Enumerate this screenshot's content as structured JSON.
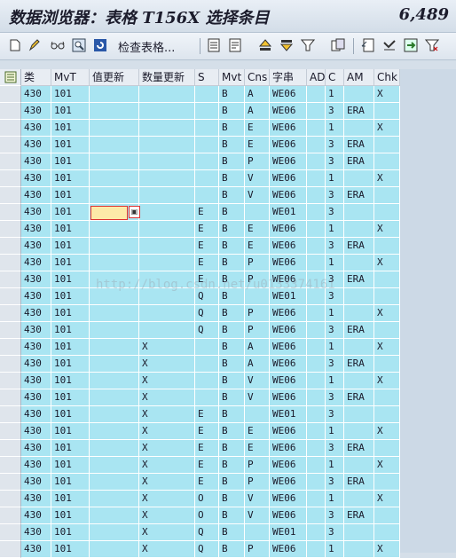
{
  "title": "数据浏览器：表格 T156X 选择条目",
  "entry_count": "6,489",
  "toolbar": {
    "check_table_label": "检查表格...",
    "icons": [
      "new-page-icon",
      "edit-pencil-icon",
      "glasses-icon",
      "find-icon",
      "refresh-icon",
      "details-icon",
      "print-icon",
      "sort-ascending-icon",
      "sort-descending-icon",
      "filter-icon",
      "total-icon",
      "export-icon",
      "layout-icon",
      "save-icon",
      "unfilter-icon"
    ]
  },
  "watermark": "http://blog.csdn.net/u0133374161",
  "table": {
    "headers": [
      "类",
      "MvT",
      "值更新",
      "数量更新",
      "S",
      "Mvt",
      "Cns",
      "字串",
      "AD",
      "C",
      "AM",
      "Chk"
    ],
    "rows": [
      [
        "430",
        "101",
        "",
        "",
        "",
        "B",
        "A",
        "WE06",
        "",
        "1",
        "",
        "X"
      ],
      [
        "430",
        "101",
        "",
        "",
        "",
        "B",
        "A",
        "WE06",
        "",
        "3",
        "ERA",
        ""
      ],
      [
        "430",
        "101",
        "",
        "",
        "",
        "B",
        "E",
        "WE06",
        "",
        "1",
        "",
        "X"
      ],
      [
        "430",
        "101",
        "",
        "",
        "",
        "B",
        "E",
        "WE06",
        "",
        "3",
        "ERA",
        ""
      ],
      [
        "430",
        "101",
        "",
        "",
        "",
        "B",
        "P",
        "WE06",
        "",
        "3",
        "ERA",
        ""
      ],
      [
        "430",
        "101",
        "",
        "",
        "",
        "B",
        "V",
        "WE06",
        "",
        "1",
        "",
        "X"
      ],
      [
        "430",
        "101",
        "",
        "",
        "",
        "B",
        "V",
        "WE06",
        "",
        "3",
        "ERA",
        ""
      ],
      [
        "430",
        "101",
        "",
        "",
        "E",
        "B",
        "",
        "WE01",
        "",
        "3",
        "",
        ""
      ],
      [
        "430",
        "101",
        "",
        "",
        "E",
        "B",
        "E",
        "WE06",
        "",
        "1",
        "",
        "X"
      ],
      [
        "430",
        "101",
        "",
        "",
        "E",
        "B",
        "E",
        "WE06",
        "",
        "3",
        "ERA",
        ""
      ],
      [
        "430",
        "101",
        "",
        "",
        "E",
        "B",
        "P",
        "WE06",
        "",
        "1",
        "",
        "X"
      ],
      [
        "430",
        "101",
        "",
        "",
        "E",
        "B",
        "P",
        "WE06",
        "",
        "3",
        "ERA",
        ""
      ],
      [
        "430",
        "101",
        "",
        "",
        "Q",
        "B",
        "",
        "WE01",
        "",
        "3",
        "",
        ""
      ],
      [
        "430",
        "101",
        "",
        "",
        "Q",
        "B",
        "P",
        "WE06",
        "",
        "1",
        "",
        "X"
      ],
      [
        "430",
        "101",
        "",
        "",
        "Q",
        "B",
        "P",
        "WE06",
        "",
        "3",
        "ERA",
        ""
      ],
      [
        "430",
        "101",
        "",
        "X",
        "",
        "B",
        "A",
        "WE06",
        "",
        "1",
        "",
        "X"
      ],
      [
        "430",
        "101",
        "",
        "X",
        "",
        "B",
        "A",
        "WE06",
        "",
        "3",
        "ERA",
        ""
      ],
      [
        "430",
        "101",
        "",
        "X",
        "",
        "B",
        "V",
        "WE06",
        "",
        "1",
        "",
        "X"
      ],
      [
        "430",
        "101",
        "",
        "X",
        "",
        "B",
        "V",
        "WE06",
        "",
        "3",
        "ERA",
        ""
      ],
      [
        "430",
        "101",
        "",
        "X",
        "E",
        "B",
        "",
        "WE01",
        "",
        "3",
        "",
        ""
      ],
      [
        "430",
        "101",
        "",
        "X",
        "E",
        "B",
        "E",
        "WE06",
        "",
        "1",
        "",
        "X"
      ],
      [
        "430",
        "101",
        "",
        "X",
        "E",
        "B",
        "E",
        "WE06",
        "",
        "3",
        "ERA",
        ""
      ],
      [
        "430",
        "101",
        "",
        "X",
        "E",
        "B",
        "P",
        "WE06",
        "",
        "1",
        "",
        "X"
      ],
      [
        "430",
        "101",
        "",
        "X",
        "E",
        "B",
        "P",
        "WE06",
        "",
        "3",
        "ERA",
        ""
      ],
      [
        "430",
        "101",
        "",
        "X",
        "O",
        "B",
        "V",
        "WE06",
        "",
        "1",
        "",
        "X"
      ],
      [
        "430",
        "101",
        "",
        "X",
        "O",
        "B",
        "V",
        "WE06",
        "",
        "3",
        "ERA",
        ""
      ],
      [
        "430",
        "101",
        "",
        "X",
        "Q",
        "B",
        "",
        "WE01",
        "",
        "3",
        "",
        ""
      ],
      [
        "430",
        "101",
        "",
        "X",
        "Q",
        "B",
        "P",
        "WE06",
        "",
        "1",
        "",
        "X"
      ]
    ]
  }
}
